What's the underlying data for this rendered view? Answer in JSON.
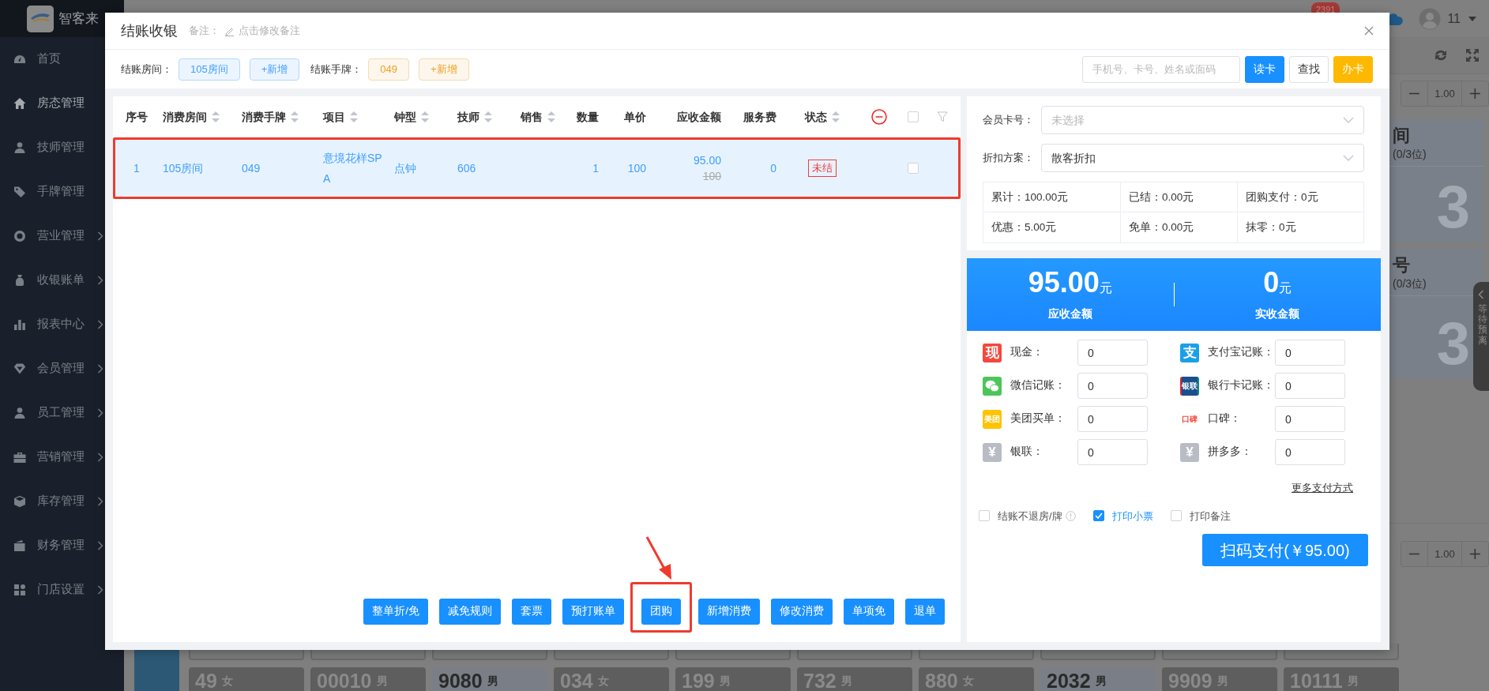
{
  "sidebar": {
    "brand": "智客来",
    "items": [
      {
        "label": "首页",
        "expandable": false,
        "selected": false
      },
      {
        "label": "房态管理",
        "expandable": false,
        "selected": true
      },
      {
        "label": "技师管理",
        "expandable": false,
        "selected": false
      },
      {
        "label": "手牌管理",
        "expandable": false,
        "selected": false
      },
      {
        "label": "营业管理",
        "expandable": true,
        "selected": false
      },
      {
        "label": "收银账单",
        "expandable": true,
        "selected": false
      },
      {
        "label": "报表中心",
        "expandable": true,
        "selected": false
      },
      {
        "label": "会员管理",
        "expandable": true,
        "selected": false
      },
      {
        "label": "员工管理",
        "expandable": true,
        "selected": false
      },
      {
        "label": "营销管理",
        "expandable": true,
        "selected": false
      },
      {
        "label": "库存管理",
        "expandable": true,
        "selected": false
      },
      {
        "label": "财务管理",
        "expandable": true,
        "selected": false
      },
      {
        "label": "门店设置",
        "expandable": true,
        "selected": false
      }
    ]
  },
  "topbar": {
    "badge": "2391",
    "user": "11"
  },
  "background": {
    "steppers": [
      {
        "value": "1.00"
      },
      {
        "value": "1.00"
      }
    ],
    "rooms": [
      {
        "name": "间",
        "capacity": "(0/3位)",
        "number": "3"
      },
      {
        "name": "号",
        "capacity": "(0/3位)",
        "number": "3"
      }
    ],
    "side_tab": "等待预离",
    "cards": [
      {
        "number": "49",
        "gender": "女",
        "active": false
      },
      {
        "number": "00010",
        "gender": "男",
        "active": false
      },
      {
        "number": "9080",
        "gender": "男",
        "active": true
      },
      {
        "number": "034",
        "gender": "女",
        "active": false
      },
      {
        "number": "199",
        "gender": "男",
        "active": false
      },
      {
        "number": "732",
        "gender": "男",
        "active": false
      },
      {
        "number": "880",
        "gender": "女",
        "active": false
      },
      {
        "number": "2032",
        "gender": "男",
        "active": true
      },
      {
        "number": "9909",
        "gender": "男",
        "active": false
      },
      {
        "number": "10111",
        "gender": "男",
        "active": false
      }
    ]
  },
  "dialog": {
    "title": "结账收银",
    "note_label": "备注：",
    "note_link": "点击修改备注",
    "room_label": "结账房间：",
    "room_tag": "105房间",
    "room_add": "+新增",
    "tag_label": "结账手牌：",
    "tag_value": "049",
    "tag_add": "+新增",
    "search": {
      "placeholder": "手机号、卡号、姓名或面码"
    },
    "search_buttons": [
      {
        "label": "读卡",
        "kind": "primary"
      },
      {
        "label": "查找",
        "kind": "default"
      },
      {
        "label": "办卡",
        "kind": "warning"
      }
    ],
    "table": {
      "select_all_checked": false,
      "columns": [
        {
          "label": "序号",
          "sortable": false
        },
        {
          "label": "消费房间",
          "sortable": true
        },
        {
          "label": "消费手牌",
          "sortable": true
        },
        {
          "label": "项目",
          "sortable": true
        },
        {
          "label": "钟型",
          "sortable": true
        },
        {
          "label": "技师",
          "sortable": true
        },
        {
          "label": "销售",
          "sortable": true
        },
        {
          "label": "数量",
          "sortable": false
        },
        {
          "label": "单价",
          "sortable": false
        },
        {
          "label": "应收金额",
          "sortable": false
        },
        {
          "label": "服务费",
          "sortable": false
        },
        {
          "label": "状态",
          "sortable": true
        }
      ],
      "rows": [
        {
          "index": "1",
          "room": "105房间",
          "tag": "049",
          "item": "意境花样SPA",
          "clock_type": "点钟",
          "technician": "606",
          "quantity": "1",
          "unit_price": "100",
          "amount": "95.00",
          "original_amount": "100",
          "service_fee": "0",
          "status": "未结",
          "checked": false,
          "selected": true,
          "highlighted": true
        }
      ]
    },
    "actions": [
      {
        "label": "整单折/免",
        "highlighted": false
      },
      {
        "label": "减免规则",
        "highlighted": false
      },
      {
        "label": "套票",
        "highlighted": false
      },
      {
        "label": "预打账单",
        "highlighted": false
      },
      {
        "label": "团购",
        "highlighted": true
      },
      {
        "label": "新增消费",
        "highlighted": false
      },
      {
        "label": "修改消费",
        "highlighted": false
      },
      {
        "label": "单项免",
        "highlighted": false
      },
      {
        "label": "退单",
        "highlighted": false
      }
    ],
    "member_card": {
      "label": "会员卡号：",
      "placeholder": "未选择"
    },
    "discount": {
      "label": "折扣方案：",
      "value": "散客折扣"
    },
    "summary": [
      "累计：100.00元",
      "已结：0.00元",
      "团购支付：0元",
      "优惠：5.00元",
      "免单：0.00元",
      "抹零：0元"
    ],
    "totals": [
      {
        "amount": "95.00",
        "unit": "元",
        "label": "应收金额"
      },
      {
        "amount": "0",
        "unit": "元",
        "label": "实收金额"
      }
    ],
    "payments": [
      {
        "label": "现金：",
        "value": "0",
        "icon": {
          "kind": "glyph",
          "text": "现",
          "color": "#f5473d"
        }
      },
      {
        "label": "支付宝记账：",
        "value": "0",
        "icon": {
          "kind": "glyph",
          "text": "支",
          "color": "#1aa0e8"
        }
      },
      {
        "label": "微信记账：",
        "value": "0",
        "icon": {
          "kind": "wechat",
          "color": "#4cc55a"
        }
      },
      {
        "label": "银行卡记账：",
        "value": "0",
        "icon": {
          "kind": "stripes",
          "text": "银联"
        }
      },
      {
        "label": "美团买单：",
        "value": "0",
        "icon": {
          "kind": "glyph",
          "text": "美团",
          "color": "#ffc300"
        }
      },
      {
        "label": "口碑：",
        "value": "0",
        "icon": {
          "kind": "plain",
          "text": "口碑",
          "color": "#f5473d"
        }
      },
      {
        "label": "银联：",
        "value": "0",
        "icon": {
          "kind": "glyph",
          "text": "¥",
          "color": "#b8bcc4"
        }
      },
      {
        "label": "拼多多：",
        "value": "0",
        "icon": {
          "kind": "glyph",
          "text": "¥",
          "color": "#b8bcc4"
        }
      }
    ],
    "more_payments": "更多支付方式",
    "options": [
      {
        "label": "结账不退房/牌",
        "checked": false,
        "info": true
      },
      {
        "label": "打印小票",
        "checked": true
      },
      {
        "label": "打印备注",
        "checked": false
      }
    ],
    "pay_button": "扫码支付(￥95.00)"
  }
}
